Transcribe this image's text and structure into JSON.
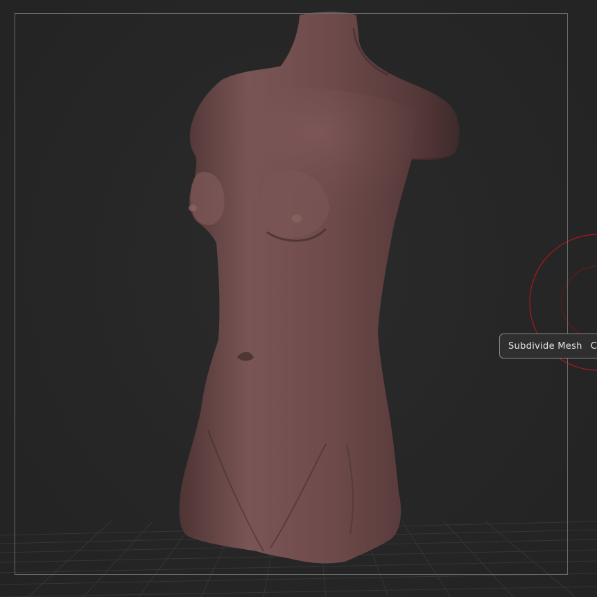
{
  "viewport": {
    "background": "#262626",
    "model": "female-torso-sculpt",
    "model_color": "#6e4a4a"
  },
  "context_menu": {
    "item_label": "Subdivide Mesh",
    "next_item_label": "C"
  },
  "brush_cursor": {
    "color": "#b01818"
  }
}
